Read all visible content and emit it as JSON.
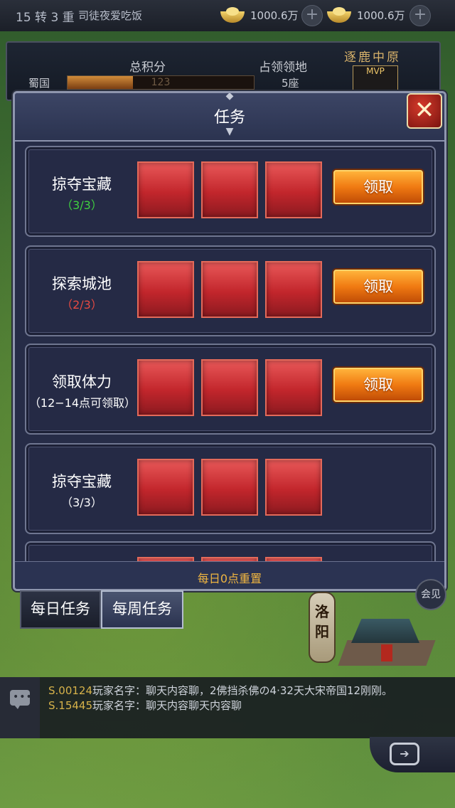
{
  "topbar": {
    "rank": "15 转 3 重",
    "player_name": "司徒夜爱吃饭",
    "currency1": "1000.6万",
    "currency2": "1000.6万",
    "plus": "+"
  },
  "score_panel": {
    "total_label": "总积分",
    "territory_label": "占领领地",
    "kingdom": "蜀国",
    "total_value": "123",
    "total_progress": 0.35,
    "territory_value": "5座",
    "event_title": "逐鹿中原",
    "mvp_label": "MVP"
  },
  "dialog": {
    "title": "任务",
    "close_symbol": "✕",
    "footer": "每日0点重置",
    "tasks": [
      {
        "name": "掠夺宝藏",
        "progress": "（3/3）",
        "progress_color": "#3fd13f",
        "claim_label": "领取"
      },
      {
        "name": "探索城池",
        "progress": "（2/3）",
        "progress_color": "#e84a42",
        "claim_label": "领取"
      },
      {
        "name": "领取体力",
        "progress": "（12−14点可领取）",
        "progress_color": "#ffffff",
        "claim_label": "领取"
      },
      {
        "name": "掠夺宝藏",
        "progress": "（3/3）",
        "progress_color": "#ffffff",
        "claim_label": ""
      }
    ]
  },
  "tabs": {
    "daily": "每日任务",
    "weekly": "每周任务"
  },
  "map": {
    "city_name": "洛阳",
    "side_button": "会见"
  },
  "chat": {
    "lines": [
      {
        "sid": "S.00124",
        "text": "玩家名字：聊天内容聊，2佛挡杀佛の4·32天大宋帝国12刚刚。"
      },
      {
        "sid": "S.15445",
        "text": "玩家名字：聊天内容聊天内容聊"
      }
    ]
  },
  "colors": {
    "claim_button": "#f07a12",
    "reward_slot": "#c2262c",
    "footer_text": "#f0b640",
    "dialog_bg": "#262c47"
  },
  "icons": [
    "gold-ingot-icon",
    "plus-icon",
    "close-icon",
    "chat-icon",
    "return-icon"
  ]
}
